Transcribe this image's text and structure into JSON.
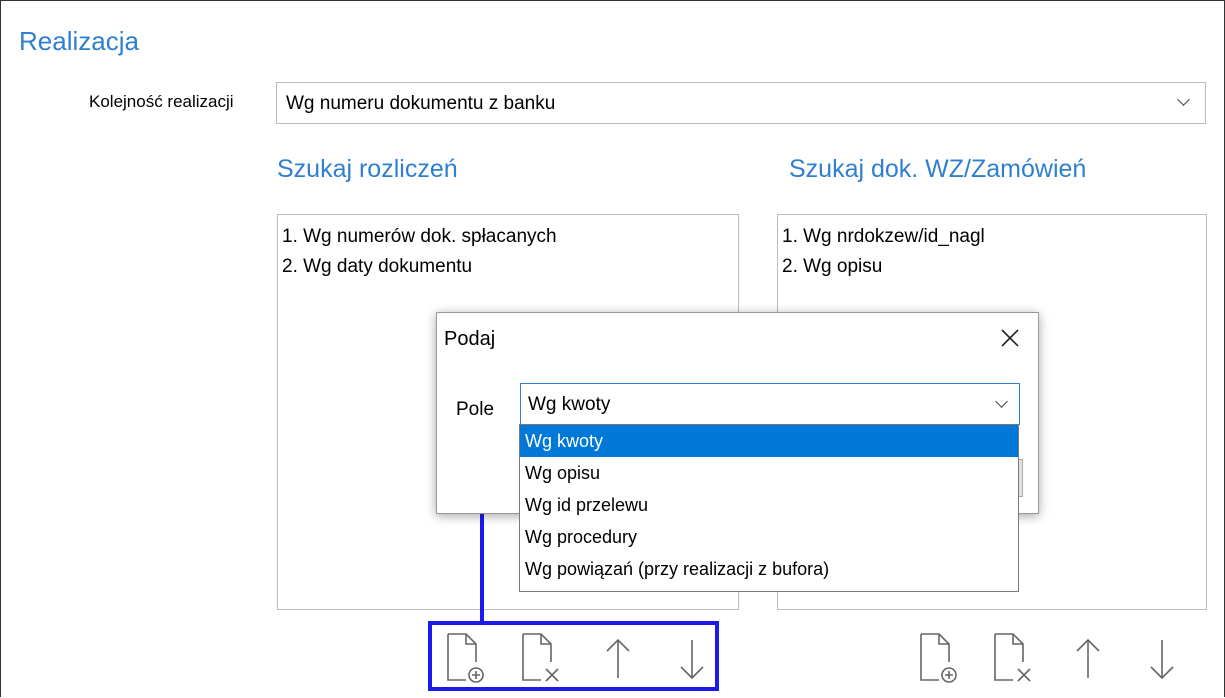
{
  "section": {
    "title": "Realizacja"
  },
  "order": {
    "label": "Kolejność realizacji",
    "value": "Wg numeru dokumentu z banku"
  },
  "left_group": {
    "title": "Szukaj rozliczeń",
    "items": [
      "1. Wg numerów dok. spłacanych",
      "2. Wg daty dokumentu"
    ]
  },
  "right_group": {
    "title": "Szukaj dok. WZ/Zamówień",
    "items": [
      "1. Wg nrdokzew/id_nagl",
      "2. Wg opisu"
    ]
  },
  "dialog": {
    "title": "Podaj",
    "field_label": "Pole",
    "selected": "Wg kwoty",
    "options": [
      "Wg kwoty",
      "Wg opisu",
      "Wg id przelewu",
      "Wg procedury",
      "Wg powiązań (przy realizacji z bufora)"
    ]
  },
  "toolbar": [
    "add-document-icon",
    "remove-document-icon",
    "arrow-up-icon",
    "arrow-down-icon"
  ],
  "colors": {
    "accent": "#2f7fd1",
    "highlight": "#1a1aef",
    "selection": "#0078d7"
  }
}
